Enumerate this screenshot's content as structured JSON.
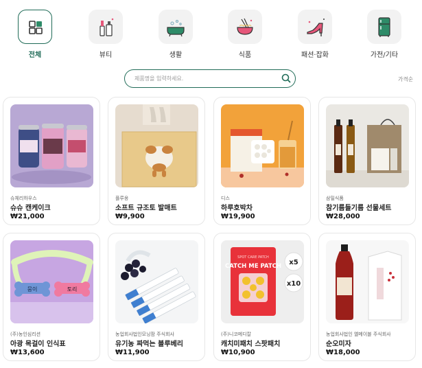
{
  "categories": [
    {
      "label": "전체",
      "icon": "grid-icon",
      "active": true
    },
    {
      "label": "뷰티",
      "icon": "cosmetics-icon",
      "active": false
    },
    {
      "label": "생활",
      "icon": "bathtub-icon",
      "active": false
    },
    {
      "label": "식품",
      "icon": "noodle-bowl-icon",
      "active": false
    },
    {
      "label": "패션·잡화",
      "icon": "high-heel-icon",
      "active": false
    },
    {
      "label": "가전/기타",
      "icon": "refrigerator-icon",
      "active": false
    }
  ],
  "search": {
    "placeholder": "제품명을 입력하세요.",
    "value": ""
  },
  "sort_label": "가격순",
  "products": [
    {
      "seller": "슈체리하우스",
      "name": "슈슈 캔케이크",
      "price": "₩21,000"
    },
    {
      "seller": "플루옹",
      "name": "소프트 규조토 발매트",
      "price": "₩9,900"
    },
    {
      "seller": "디스",
      "name": "하루호박차",
      "price": "₩19,900"
    },
    {
      "seller": "삼밀식품",
      "name": "참기름들기름 선물세트",
      "price": "₩28,000"
    },
    {
      "seller": "(주)농인심리션",
      "name": "아광 목걸이 인식표",
      "price": "₩13,600"
    },
    {
      "seller": "농업회사법인모닝팜 주식회사",
      "name": "유기농 짜먹는 블루베리",
      "price": "₩11,900"
    },
    {
      "seller": "(주)니코메디칼",
      "name": "캐치미패치 스팟패치",
      "price": "₩10,900"
    },
    {
      "seller": "농업회사법인 옐메이블 주식회사",
      "name": "순오미자",
      "price": "₩18,000"
    }
  ],
  "patch_image": {
    "packet_top": "SPOT CARE PATCH",
    "packet_title": "CATCH ME PATCH",
    "badge_5": "x5",
    "badge_10": "x10"
  },
  "tag_image": {
    "left_tag": "뭉이",
    "right_tag": "토리"
  },
  "colors": {
    "accent": "#1f6b57"
  }
}
